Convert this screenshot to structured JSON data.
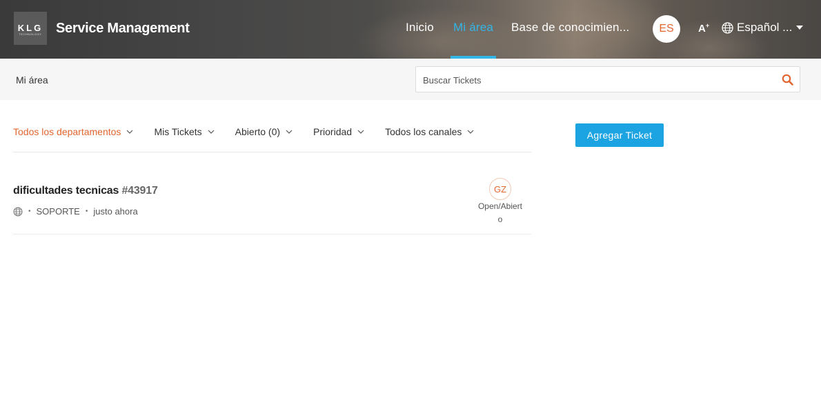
{
  "header": {
    "logo_text": "KLG",
    "logo_subtext": "TECHNOLOGY",
    "brand": "Service Management",
    "nav": [
      {
        "label": "Inicio"
      },
      {
        "label": "Mi área"
      },
      {
        "label": "Base de conocimien..."
      }
    ],
    "active_nav": "Mi área",
    "avatar_initials": "ES",
    "font_toggle": "A",
    "language": "Español ..."
  },
  "subbar": {
    "breadcrumb": "Mi área",
    "search_placeholder": "Buscar Tickets"
  },
  "filters": [
    {
      "label": "Todos los departamentos",
      "active": true
    },
    {
      "label": "Mis Tickets"
    },
    {
      "label": "Abierto (0)"
    },
    {
      "label": "Prioridad"
    },
    {
      "label": "Todos los canales"
    }
  ],
  "add_ticket_label": "Agregar Ticket",
  "tickets": [
    {
      "subject": "dificultades tecnicas",
      "number": "#43917",
      "department": "SOPORTE",
      "time": "justo ahora",
      "assignee_initials": "GZ",
      "status": "Open/Abierto"
    }
  ],
  "colors": {
    "accent": "#1ba3e2",
    "nav_active": "#33b5e8",
    "orange": "#e0652f"
  },
  "icons": {
    "search": "search-icon",
    "globe": "globe-icon",
    "chevron": "chevron-down-icon"
  }
}
